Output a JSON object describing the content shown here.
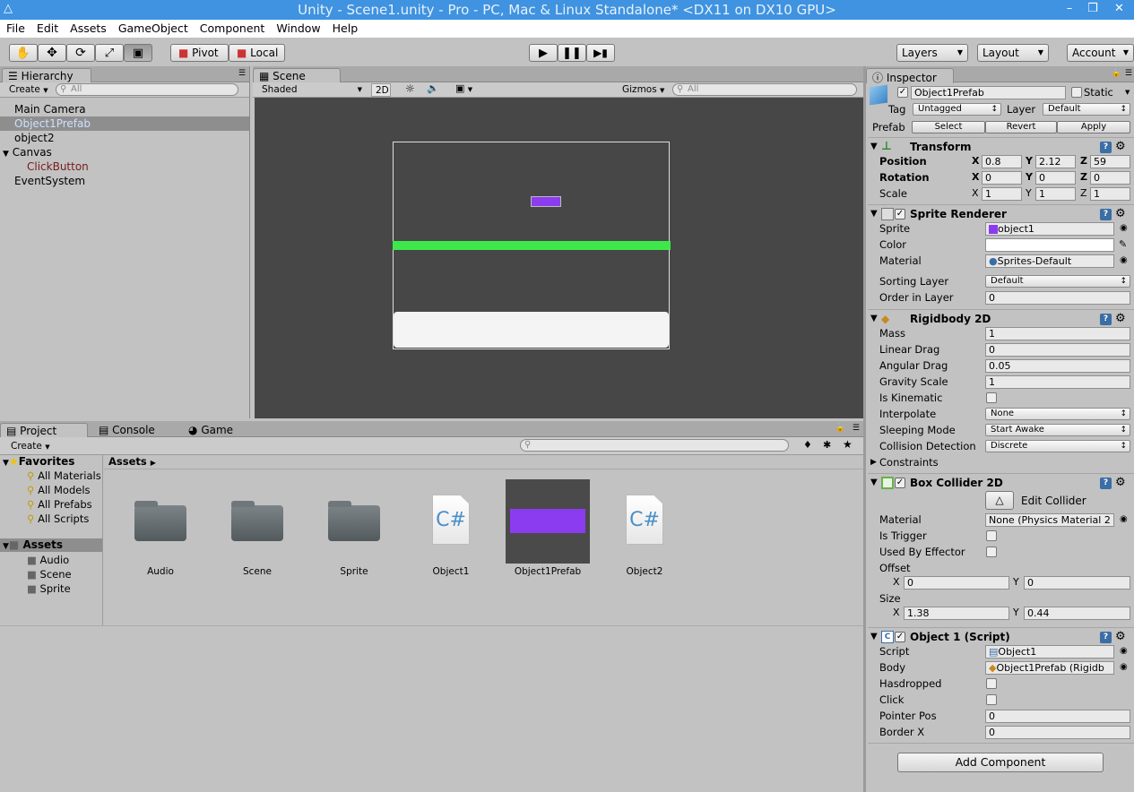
{
  "window": {
    "title": "Unity - Scene1.unity - Pro - PC, Mac & Linux Standalone* <DX11 on DX10 GPU>",
    "minimize": "–",
    "restore": "❒",
    "close": "✕"
  },
  "menu": [
    "File",
    "Edit",
    "Assets",
    "GameObject",
    "Component",
    "Window",
    "Help"
  ],
  "toolbar": {
    "pivot": "Pivot",
    "local": "Local",
    "layers": "Layers",
    "layout": "Layout",
    "account": "Account"
  },
  "hierarchy": {
    "tab": "Hierarchy",
    "create": "Create",
    "search_placeholder": "All",
    "items": [
      {
        "label": "Main Camera"
      },
      {
        "label": "Object1Prefab"
      },
      {
        "label": "object2"
      },
      {
        "label": "Canvas"
      },
      {
        "label": "ClickButton"
      },
      {
        "label": "EventSystem"
      }
    ]
  },
  "scene": {
    "tab": "Scene",
    "shading": "Shaded",
    "mode_2d": "2D",
    "gizmos": "Gizmos",
    "search_placeholder": "All",
    "bg_color": "#474747",
    "bar_color": "#3ee84a",
    "object_color": "#8c3cf0"
  },
  "project": {
    "tabs": [
      "Project",
      "Console",
      "Game"
    ],
    "create": "Create",
    "favorites_label": "Favorites",
    "favorites": [
      "All Materials",
      "All Models",
      "All Prefabs",
      "All Scripts"
    ],
    "assets_label": "Assets",
    "asset_folders": [
      "Audio",
      "Scene",
      "Sprite"
    ],
    "breadcrumb": "Assets",
    "assets": [
      {
        "name": "Audio",
        "icon": "folder-icon"
      },
      {
        "name": "Scene",
        "icon": "folder-icon"
      },
      {
        "name": "Sprite",
        "icon": "folder-icon"
      },
      {
        "name": "Object1",
        "icon": "csharp-file-icon"
      },
      {
        "name": "Object1Prefab",
        "icon": "prefab-icon"
      },
      {
        "name": "Object2",
        "icon": "csharp-file-icon"
      }
    ]
  },
  "inspector": {
    "tab": "Inspector",
    "object_name": "Object1Prefab",
    "static_label": "Static",
    "tag_label": "Tag",
    "tag_value": "Untagged",
    "layer_label": "Layer",
    "layer_value": "Default",
    "prefab_label": "Prefab",
    "prefab_select": "Select",
    "prefab_revert": "Revert",
    "prefab_apply": "Apply",
    "transform": {
      "title": "Transform",
      "position_label": "Position",
      "rotation_label": "Rotation",
      "scale_label": "Scale",
      "x": "X",
      "y": "Y",
      "z": "Z",
      "position": [
        "0.8",
        "2.12",
        "59"
      ],
      "rotation": [
        "0",
        "0",
        "0"
      ],
      "scale": [
        "1",
        "1",
        "1"
      ]
    },
    "sprite_renderer": {
      "title": "Sprite Renderer",
      "sprite_label": "Sprite",
      "sprite_value": "object1",
      "color_label": "Color",
      "material_label": "Material",
      "material_value": "Sprites-Default",
      "sorting_label": "Sorting Layer",
      "sorting_value": "Default",
      "order_label": "Order in Layer",
      "order_value": "0"
    },
    "rigidbody": {
      "title": "Rigidbody 2D",
      "mass_label": "Mass",
      "mass": "1",
      "linear_label": "Linear Drag",
      "linear": "0",
      "angular_label": "Angular Drag",
      "angular": "0.05",
      "gravity_label": "Gravity Scale",
      "gravity": "1",
      "kinematic_label": "Is Kinematic",
      "interpolate_label": "Interpolate",
      "interpolate": "None",
      "sleeping_label": "Sleeping Mode",
      "sleeping": "Start Awake",
      "collision_label": "Collision Detection",
      "collision": "Discrete",
      "constraints_label": "Constraints"
    },
    "box_collider": {
      "title": "Box Collider 2D",
      "edit_label": "Edit Collider",
      "material_label": "Material",
      "material_value": "None (Physics Material 2",
      "trigger_label": "Is Trigger",
      "effector_label": "Used By Effector",
      "offset_label": "Offset",
      "offset_x": "0",
      "offset_y": "0",
      "size_label": "Size",
      "size_x": "1.38",
      "size_y": "0.44",
      "x": "X",
      "y": "Y"
    },
    "script": {
      "title": "Object 1 (Script)",
      "script_label": "Script",
      "script_value": "Object1",
      "body_label": "Body",
      "body_value": "Object1Prefab (Rigidb",
      "hasdropped_label": "Hasdropped",
      "click_label": "Click",
      "pointer_label": "Pointer Pos",
      "pointer_value": "0",
      "border_label": "Border X",
      "border_value": "0"
    },
    "add_component": "Add Component"
  }
}
